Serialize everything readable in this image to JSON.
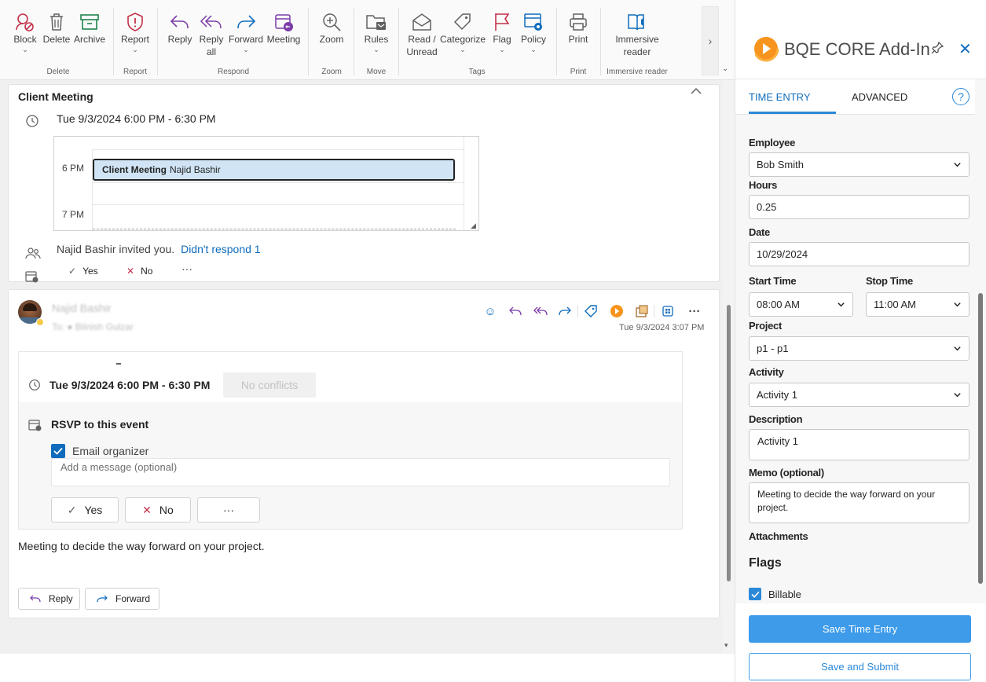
{
  "ribbon": {
    "buttons": {
      "block": "Block",
      "delete": "Delete",
      "archive": "Archive",
      "report": "Report",
      "reply": "Reply",
      "reply_all_1": "Reply",
      "reply_all_2": "all",
      "forward": "Forward",
      "meeting": "Meeting",
      "zoom": "Zoom",
      "rules": "Rules",
      "read_unread_1": "Read /",
      "read_unread_2": "Unread",
      "categorize": "Categorize",
      "flag": "Flag",
      "policy": "Policy",
      "print": "Print",
      "immersive_1": "Immersive",
      "immersive_2": "reader"
    },
    "groups": {
      "delete": "Delete",
      "report": "Report",
      "respond": "Respond",
      "zoom": "Zoom",
      "move": "Move",
      "tags": "Tags",
      "print": "Print",
      "immersive": "Immersive reader"
    },
    "more": "›"
  },
  "meeting": {
    "title": "Client Meeting",
    "time": "Tue 9/3/2024 6:00 PM - 6:30 PM",
    "calendar": {
      "label_6pm": "6 PM",
      "label_7pm": "7 PM",
      "event_title": "Client Meeting",
      "event_organizer": "Najid Bashir"
    },
    "invite_text": "Najid Bashir invited you.",
    "invite_link": "Didn't respond 1",
    "yes": "Yes",
    "no": "No",
    "more": "···"
  },
  "email": {
    "sender": "Najid Bashir",
    "to": "To: ● Bilnish Gulzar",
    "date": "Tue 9/3/2024 3:07 PM",
    "event_time": "Tue 9/3/2024 6:00 PM - 6:30 PM",
    "no_conflicts": "No conflicts",
    "rsvp_title": "RSVP to this event",
    "email_organizer": "Email organizer",
    "message_placeholder": "Add a message (optional)",
    "yes": "Yes",
    "no": "No",
    "more": "···",
    "body": "Meeting to decide the way forward on your project.",
    "reply": "Reply",
    "forward": "Forward",
    "overflow": "···"
  },
  "addin": {
    "title": "BQE CORE Add-In",
    "tabs": {
      "time_entry": "TIME ENTRY",
      "advanced": "ADVANCED"
    },
    "help": "?",
    "close": "✕",
    "form": {
      "employee_label": "Employee",
      "employee_value": "Bob Smith",
      "hours_label": "Hours",
      "hours_value": "0.25",
      "date_label": "Date",
      "date_value": "10/29/2024",
      "start_label": "Start Time",
      "start_value": "08:00 AM",
      "stop_label": "Stop Time",
      "stop_value": "11:00 AM",
      "project_label": "Project",
      "project_value": "p1 - p1",
      "activity_label": "Activity",
      "activity_value": "Activity 1",
      "description_label": "Description",
      "description_value": "Activity 1",
      "memo_label": "Memo (optional)",
      "memo_value": "Meeting to decide the way forward on your project.",
      "attachments_label": "Attachments",
      "flags_heading": "Flags",
      "billable_label": "Billable",
      "billable_checked": true
    },
    "buttons": {
      "save_entry": "Save Time Entry",
      "save_submit": "Save and Submit"
    }
  },
  "colors": {
    "accent": "#0f6cbd",
    "addin_button": "#3d9be9",
    "red_icon": "#c4314b",
    "purple_icon": "#7b3ca8",
    "green_icon": "#107c41",
    "calendar_event": "#d0e4f5",
    "logo_orange": "#f7941d"
  }
}
